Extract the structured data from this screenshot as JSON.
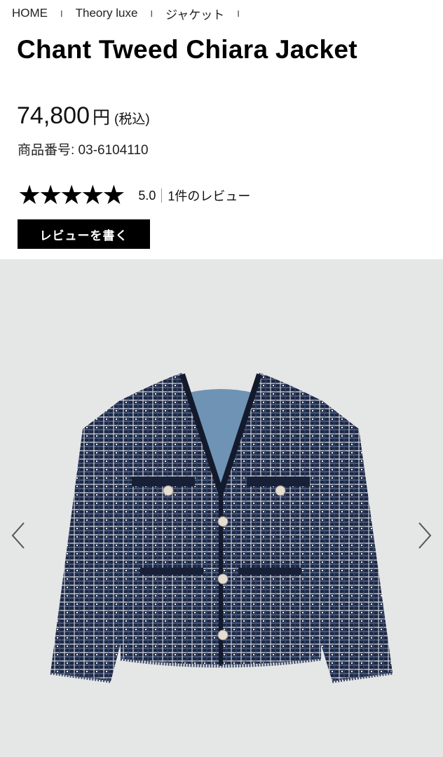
{
  "breadcrumb": {
    "items": [
      "HOME",
      "Theory luxe",
      "ジャケット"
    ],
    "separator": "I"
  },
  "product": {
    "title": "Chant Tweed Chiara Jacket",
    "price_value": "74,800",
    "price_unit": "円",
    "tax_note": "(税込)",
    "sku_label": "商品番号: 03-6104110"
  },
  "rating": {
    "stars": 5,
    "score": "5.0",
    "reviews_text": "1件のレビュー"
  },
  "review_button": {
    "label": "レビューを書く"
  },
  "gallery": {
    "prev_icon": "chevron-left-icon",
    "next_icon": "chevron-right-icon",
    "background": "#e5e6e6",
    "jacket_color": "#1f2a44",
    "lining_color": "#6f92b2"
  }
}
